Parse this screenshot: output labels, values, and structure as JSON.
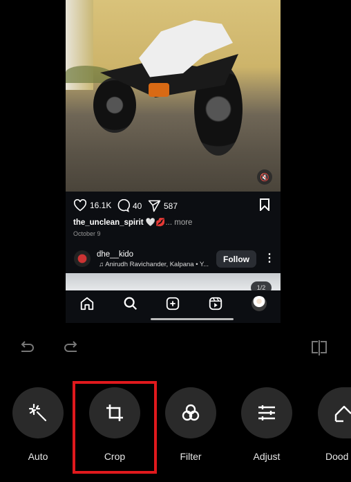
{
  "post": {
    "likes": "16.1K",
    "comments": "40",
    "shares": "587",
    "caption_user": "the_unclean_spirit",
    "caption_emoji": "🤍💋",
    "caption_more": "... more",
    "date": "October 9",
    "next_user": "dhe__kido",
    "next_song": "Anirudh Ravichander, Kalpana • Y...",
    "follow_label": "Follow",
    "pager": "1/2"
  },
  "nav_icons": [
    "home-icon",
    "search-icon",
    "create-icon",
    "reels-icon",
    "profile-icon"
  ],
  "editor": {
    "tools": [
      {
        "label": "Auto",
        "icon": "magic-wand-icon"
      },
      {
        "label": "Crop",
        "icon": "crop-icon"
      },
      {
        "label": "Filter",
        "icon": "filter-icon"
      },
      {
        "label": "Adjust",
        "icon": "sliders-icon"
      },
      {
        "label": "Dood",
        "icon": "doodle-icon"
      }
    ],
    "selected_tool": "Crop",
    "highlight_color": "#e0191d"
  }
}
